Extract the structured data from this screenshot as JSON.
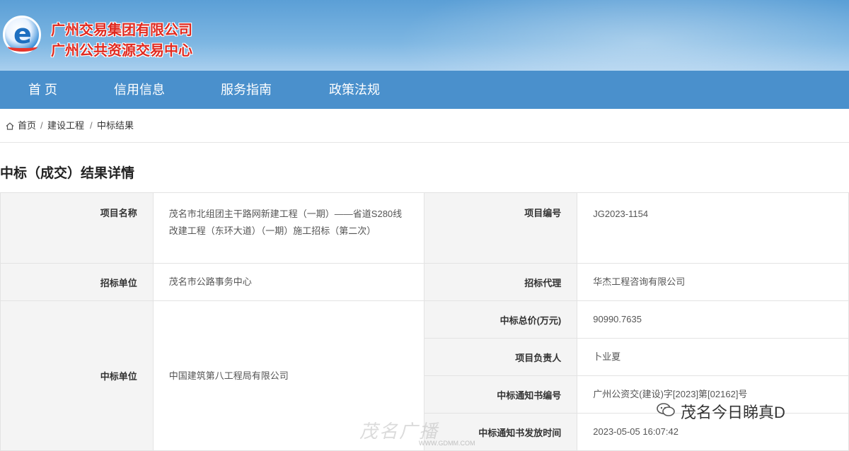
{
  "header": {
    "org_name_1": "广州交易集团有限公司",
    "org_name_2": "广州公共资源交易中心",
    "logo_letter": "e",
    "brand_color": "#e02a20",
    "header_color": "#5b9fd6"
  },
  "nav": {
    "items": [
      {
        "label": "首 页"
      },
      {
        "label": "信用信息"
      },
      {
        "label": "服务指南"
      },
      {
        "label": "政策法规"
      }
    ],
    "bg_color": "#4a90cc"
  },
  "breadcrumb": {
    "icon": "home-icon",
    "items": [
      "首页",
      "建设工程",
      "中标结果"
    ],
    "separator": "/"
  },
  "page_title": "中标（成交）结果详情",
  "details": {
    "project_name_label": "项目名称",
    "project_name": "茂名市北组团主干路网新建工程（一期）——省道S280线改建工程（东环大道）（一期）施工招标（第二次）",
    "project_no_label": "项目编号",
    "project_no": "JG2023-1154",
    "tenderer_label": "招标单位",
    "tenderer": "茂名市公路事务中心",
    "agent_label": "招标代理",
    "agent": "华杰工程咨询有限公司",
    "winner_label": "中标单位",
    "winner": "中国建筑第八工程局有限公司",
    "total_price_label": "中标总价(万元)",
    "total_price": "90990.7635",
    "manager_label": "项目负责人",
    "manager": "卜业夏",
    "notice_no_label": "中标通知书编号",
    "notice_no": "广州公资交(建设)字[2023]第[02162]号",
    "notice_time_label": "中标通知书发放时间",
    "notice_time": "2023-05-05 16:07:42"
  },
  "watermarks": {
    "left_text": "茂名广播",
    "left_url": "WWW.GDMM.COM",
    "right_icon": "wechat-icon",
    "right_text": "茂名今日睇真D"
  }
}
